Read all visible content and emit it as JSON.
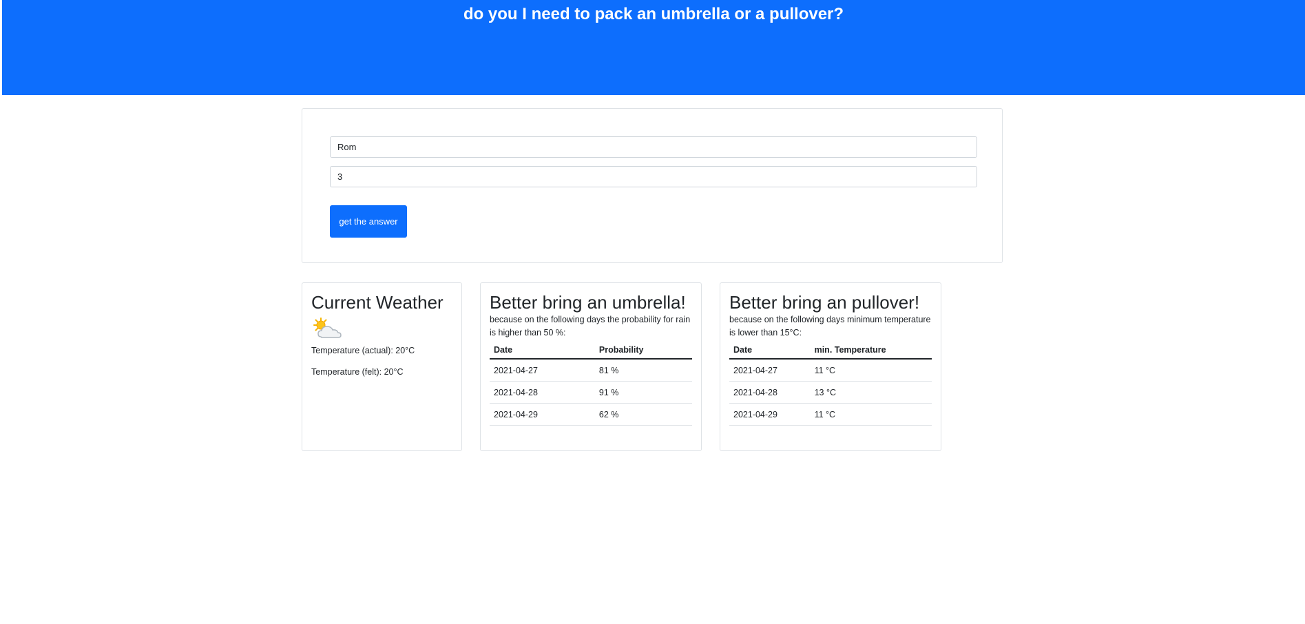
{
  "header": {
    "title": "do you I need to pack an umbrella or a pullover?"
  },
  "form": {
    "city_value": "Rom",
    "days_value": "3",
    "submit_label": "get the answer"
  },
  "current_weather": {
    "title": "Current Weather",
    "icon": "partly-cloudy-icon",
    "temp_actual": "Temperature (actual): 20°C",
    "temp_felt": "Temperature (felt): 20°C"
  },
  "umbrella": {
    "title": "Better bring an umbrella!",
    "description": "because on the following days the probability for rain is higher than 50 %:",
    "columns": [
      "Date",
      "Probability"
    ],
    "rows": [
      [
        "2021-04-27",
        "81 %"
      ],
      [
        "2021-04-28",
        "91 %"
      ],
      [
        "2021-04-29",
        "62 %"
      ]
    ]
  },
  "pullover": {
    "title": "Better bring an pullover!",
    "description": "because on the following days minimum temperature is lower than 15°C:",
    "columns": [
      "Date",
      "min. Temperature"
    ],
    "rows": [
      [
        "2021-04-27",
        "11 °C"
      ],
      [
        "2021-04-28",
        "13 °C"
      ],
      [
        "2021-04-29",
        "11 °C"
      ]
    ]
  },
  "colors": {
    "primary": "#0d6efd",
    "border": "#dee2e6"
  }
}
